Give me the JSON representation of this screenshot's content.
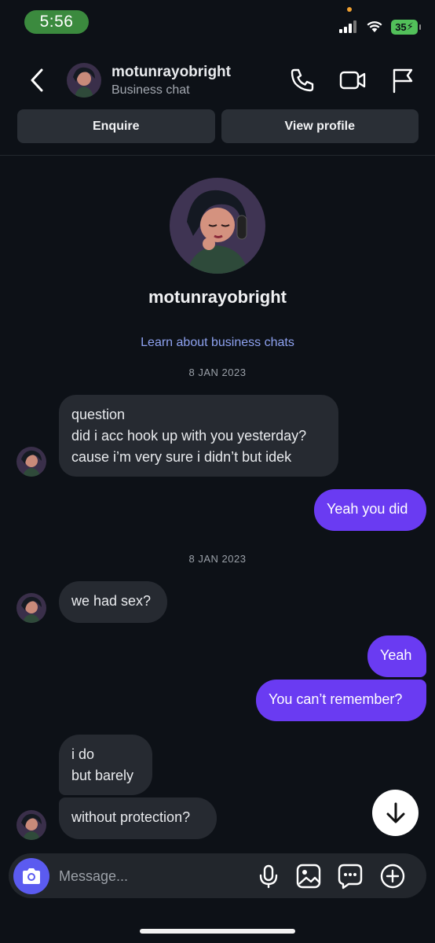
{
  "status_bar": {
    "time": "5:56",
    "battery": "35"
  },
  "header": {
    "name": "motunrayobright",
    "subtitle": "Business chat"
  },
  "actions": {
    "enquire": "Enquire",
    "view_profile": "View profile"
  },
  "profile": {
    "name": "motunrayobright",
    "learn_link": "Learn about business chats"
  },
  "dates": [
    "8 JAN 2023",
    "8 JAN 2023"
  ],
  "messages": [
    {
      "dir": "in",
      "text": "question\ndid i acc hook up with you yesterday?\ncause i’m very sure i didn’t but idek"
    },
    {
      "dir": "out",
      "text": "Yeah you did"
    },
    {
      "dir": "in",
      "text": "we had sex?"
    },
    {
      "dir": "out",
      "text": "Yeah"
    },
    {
      "dir": "out",
      "text": "You can’t remember?"
    },
    {
      "dir": "in",
      "text": "i do\nbut barely"
    },
    {
      "dir": "in",
      "text": "without protection?"
    }
  ],
  "composer": {
    "placeholder": "Message..."
  },
  "colors": {
    "background": "#0d1117",
    "outgoing": "#6a3bf2",
    "incoming": "#262a31",
    "link": "#8ea2f0",
    "camera": "#5b5bf0"
  },
  "icons": [
    "signal-icon",
    "wifi-icon",
    "battery-icon",
    "back-icon",
    "phone-icon",
    "video-icon",
    "flag-icon",
    "camera-icon",
    "microphone-icon",
    "gallery-icon",
    "sticker-icon",
    "plus-icon",
    "arrow-down-icon"
  ]
}
